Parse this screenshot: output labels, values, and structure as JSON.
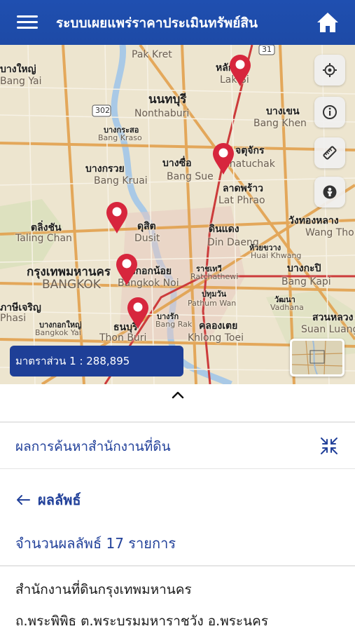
{
  "header": {
    "title": "ระบบเผยแพร่ราคาประเมินทรัพย์สิน"
  },
  "map": {
    "scale_label": "มาตราส่วน 1 : 288,895",
    "labels": [
      {
        "text": "Pak Kret",
        "cls": "md"
      },
      {
        "text": "นนทบุรี",
        "cls": "th lg"
      },
      {
        "text": "Nonthaburi",
        "cls": "md"
      },
      {
        "text": "บางกระสอ",
        "cls": "th sm"
      },
      {
        "text": "Bang Kraso",
        "cls": "sm"
      },
      {
        "text": "บางเขน",
        "cls": "th md"
      },
      {
        "text": "Bang Khen",
        "cls": "md"
      },
      {
        "text": "บางกรวย",
        "cls": "th md"
      },
      {
        "text": "Bang Kruai",
        "cls": "md"
      },
      {
        "text": "บางซื่อ",
        "cls": "th md"
      },
      {
        "text": "Bang Sue",
        "cls": "md"
      },
      {
        "text": "จตุจักร",
        "cls": "th md"
      },
      {
        "text": "Chatuchak",
        "cls": "md"
      },
      {
        "text": "ลาดพร้าว",
        "cls": "th md"
      },
      {
        "text": "Lat Phrao",
        "cls": "md"
      },
      {
        "text": "ตลิ่งชัน",
        "cls": "th md"
      },
      {
        "text": "Taling Chan",
        "cls": "md"
      },
      {
        "text": "ดุสิต",
        "cls": "th md"
      },
      {
        "text": "Dusit",
        "cls": "md"
      },
      {
        "text": "ดินแดง",
        "cls": "th md"
      },
      {
        "text": "Din Daeng",
        "cls": "md"
      },
      {
        "text": "กรุงเทพมหานคร",
        "cls": "th lg"
      },
      {
        "text": "BANGKOK",
        "cls": "lg"
      },
      {
        "text": "บางกอกน้อย",
        "cls": "th md"
      },
      {
        "text": "Bangkok Noi",
        "cls": "md"
      },
      {
        "text": "ราชเทวี",
        "cls": "th sm"
      },
      {
        "text": "Ratchathewi",
        "cls": "sm"
      },
      {
        "text": "ปทุมวัน",
        "cls": "th sm"
      },
      {
        "text": "Pathum Wan",
        "cls": "sm"
      },
      {
        "text": "บางกะปิ",
        "cls": "th md"
      },
      {
        "text": "Bang Kapi",
        "cls": "md"
      },
      {
        "text": "ภาษีเจริญ",
        "cls": "th md"
      },
      {
        "text": "Phasi",
        "cls": "md"
      },
      {
        "text": "ธนบุรี",
        "cls": "th md"
      },
      {
        "text": "Thon Buri",
        "cls": "md"
      },
      {
        "text": "คลองเตย",
        "cls": "th md"
      },
      {
        "text": "Khlong Toei",
        "cls": "md"
      },
      {
        "text": "สวนหลวง",
        "cls": "th md"
      },
      {
        "text": "Suan Luang",
        "cls": "md"
      },
      {
        "text": "วังทองหลาง",
        "cls": "th md"
      },
      {
        "text": "Wang Thonglang",
        "cls": "md"
      },
      {
        "text": "หลักสี่",
        "cls": "th md"
      },
      {
        "text": "Lak Si",
        "cls": "md"
      },
      {
        "text": "บางใหญ่",
        "cls": "th md"
      },
      {
        "text": "Bang Yai",
        "cls": "md"
      },
      {
        "text": "ห้วยขวาง",
        "cls": "th sm"
      },
      {
        "text": "Huai Khwang",
        "cls": "sm"
      },
      {
        "text": "วัฒนา",
        "cls": "th sm"
      },
      {
        "text": "Vadhana",
        "cls": "sm"
      },
      {
        "text": "บางกอกใหญ่",
        "cls": "th sm"
      },
      {
        "text": "Bangkok Yai",
        "cls": "sm"
      },
      {
        "text": "บางรัก",
        "cls": "th sm"
      },
      {
        "text": "Bang Rak",
        "cls": "sm"
      }
    ],
    "road_shields": [
      "302",
      "31"
    ]
  },
  "results": {
    "section_title": "ผลการค้นหาสำนักงานที่ดิน",
    "back_label": "ผลลัพธ์",
    "count_text": "จำนวนผลลัพธ์ 17 รายการ",
    "first_item": {
      "name": "สำนักงานที่ดินกรุงเทพมหานคร",
      "address": "ถ.พระพิพิธ ต.พระบรมมหาราชวัง อ.พระนคร"
    }
  },
  "colors": {
    "header_bg": "#1f4fb0",
    "accent_text": "#22419a",
    "pin_red": "#d7263d",
    "scale_bg": "#1e3f97"
  },
  "icons": {
    "menu": "hamburger-icon",
    "home": "home-icon",
    "locate": "locate-icon",
    "info": "info-icon",
    "measure": "ruler-icon",
    "person": "person-icon",
    "collapse": "chevron-up-icon",
    "minimize": "minimize-icon",
    "back": "arrow-left-icon"
  }
}
